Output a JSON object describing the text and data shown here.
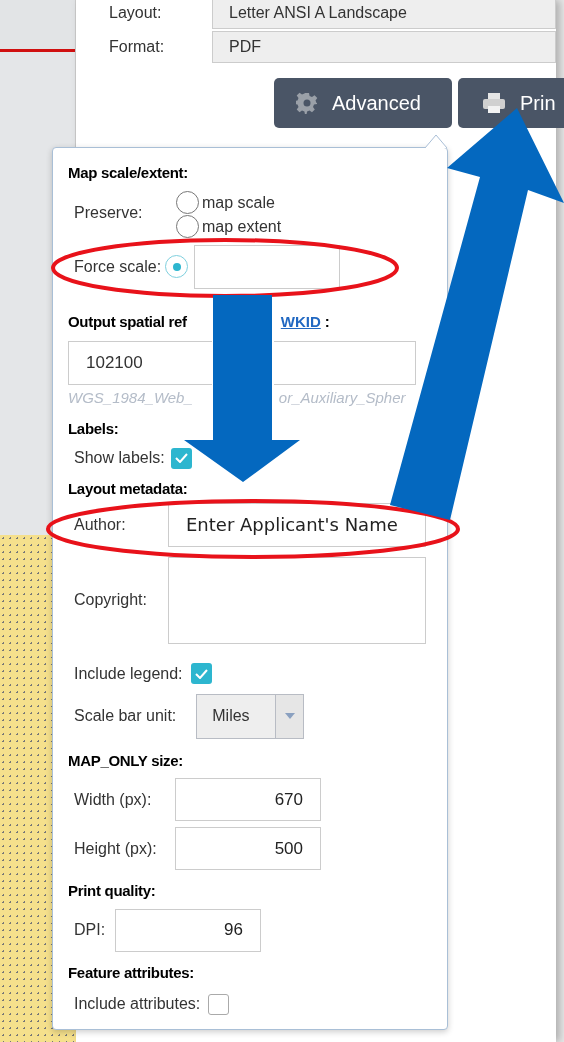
{
  "print_settings": {
    "fields": [
      {
        "label": "Layout:",
        "value": "Letter ANSI A Landscape"
      },
      {
        "label": "Format:",
        "value": "PDF"
      }
    ]
  },
  "buttons": [
    {
      "kind": "advanced",
      "label": "Advanced"
    },
    {
      "kind": "print",
      "label": "Prin"
    }
  ],
  "advanced": {
    "map_scale": {
      "heading": "Map scale/extent:",
      "preserve_label": "Preserve:",
      "options": [
        {
          "label": "map scale",
          "selected": false
        },
        {
          "label": "map extent",
          "selected": false
        }
      ],
      "force_scale": {
        "label": "Force scale:",
        "selected": true
      }
    },
    "spatial_reference": {
      "heading_start": "Output spatial ref",
      "link": "WKID",
      "heading_end": ":",
      "value": "102100",
      "hint_start": "WGS_1984_Web_",
      "hint_end": "or_Auxiliary_Spher"
    },
    "labels": {
      "heading": "Labels:",
      "show_labels": {
        "label": "Show labels:",
        "checked": true
      }
    },
    "layout_metadata": {
      "heading": "Layout metadata:",
      "author": {
        "label": "Author:",
        "value": "Enter Applicant's Name"
      },
      "copyright": {
        "label": "Copyright:"
      },
      "include_legend": {
        "label": "Include legend:",
        "checked": true
      },
      "scale_bar_unit": {
        "label": "Scale bar unit:",
        "value": "Miles"
      }
    },
    "map_only_size": {
      "heading": "MAP_ONLY size:",
      "fields": [
        {
          "label": "Width (px):",
          "value": "670"
        },
        {
          "label": "Height (px):",
          "value": "500"
        }
      ]
    },
    "print_quality": {
      "heading": "Print quality:",
      "dpi": {
        "label": "DPI:",
        "value": "96"
      }
    },
    "feature_attributes": {
      "heading": "Feature attributes:",
      "include_attributes": {
        "label": "Include attributes:",
        "checked": false
      }
    }
  }
}
